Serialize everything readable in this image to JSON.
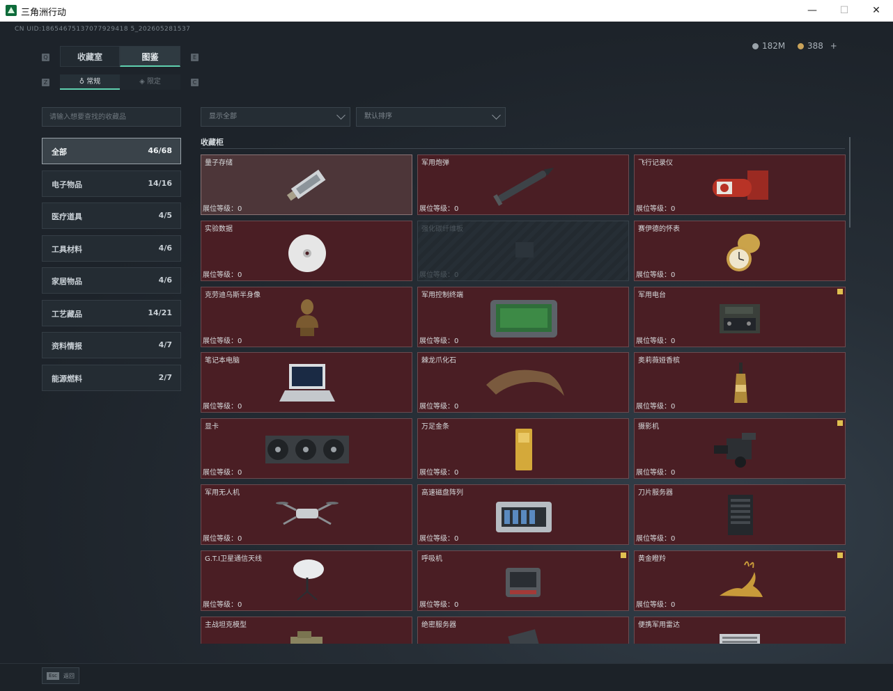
{
  "window": {
    "title": "三角洲行动",
    "minimize": "—",
    "maximize": "☐",
    "close": "✕"
  },
  "header": {
    "uid": "CN UID:18654675137077929418 5_202605281537",
    "currency1": "182M",
    "currency2": "388",
    "add": "+"
  },
  "keys": {
    "q": "Q",
    "e": "E",
    "z": "Z",
    "c": "C"
  },
  "tabs": [
    {
      "label": "收藏室"
    },
    {
      "label": "图鉴"
    }
  ],
  "subtabs": [
    {
      "label": "常规"
    },
    {
      "label": "限定"
    }
  ],
  "search": {
    "placeholder": "请输入想要查找的收藏品"
  },
  "filters": {
    "display": "显示全部",
    "sort": "默认排序"
  },
  "categories": [
    {
      "label": "全部",
      "count": "46/68"
    },
    {
      "label": "电子物品",
      "count": "14/16"
    },
    {
      "label": "医疗道具",
      "count": "4/5"
    },
    {
      "label": "工具材料",
      "count": "4/6"
    },
    {
      "label": "家居物品",
      "count": "4/6"
    },
    {
      "label": "工艺藏品",
      "count": "14/21"
    },
    {
      "label": "资料情报",
      "count": "4/7"
    },
    {
      "label": "能源燃料",
      "count": "2/7"
    }
  ],
  "section": {
    "title": "收藏柜"
  },
  "level_label": "展位等级：0",
  "items": [
    {
      "name": "量子存储"
    },
    {
      "name": "军用炮弹"
    },
    {
      "name": "飞行记录仪"
    },
    {
      "name": "实验数据"
    },
    {
      "name": "强化碳纤维板"
    },
    {
      "name": "赛伊德的怀表"
    },
    {
      "name": "克劳迪乌斯半身像"
    },
    {
      "name": "军用控制终端"
    },
    {
      "name": "军用电台"
    },
    {
      "name": "笔记本电脑"
    },
    {
      "name": "棘龙爪化石"
    },
    {
      "name": "奥莉薇娅香槟"
    },
    {
      "name": "显卡"
    },
    {
      "name": "万足金条"
    },
    {
      "name": "摄影机"
    },
    {
      "name": "军用无人机"
    },
    {
      "name": "高速磁盘阵列"
    },
    {
      "name": "刀片服务器"
    },
    {
      "name": "G.T.I卫星通信天线"
    },
    {
      "name": "呼吸机"
    },
    {
      "name": "黄金瞪羚"
    },
    {
      "name": "主战坦克模型"
    },
    {
      "name": "绝密服务器"
    },
    {
      "name": "便携军用雷达"
    }
  ],
  "bottom": {
    "esc_key": "Esc",
    "esc_label": "返回"
  },
  "colors": {
    "accent": "#5fd1b0",
    "card_bg": "#4a1e24",
    "badge": "#e0c050"
  }
}
